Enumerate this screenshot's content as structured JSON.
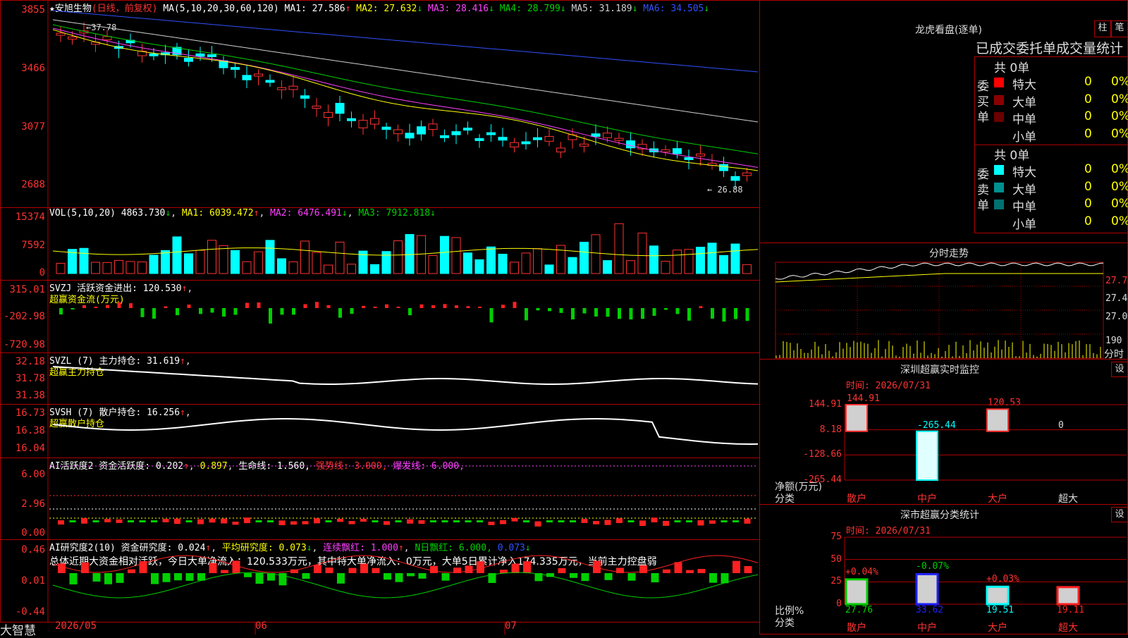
{
  "stock": {
    "name": "★安旭生物",
    "mode": "(日线，前复权)",
    "ma_params": "MA(5,10,20,30,60,120)",
    "ma": [
      {
        "label": "MA1:",
        "value": "27.586",
        "arrow": "↑",
        "color": "#ffffff"
      },
      {
        "label": "MA2:",
        "value": "27.632",
        "arrow": "↓",
        "color": "#ffff00"
      },
      {
        "label": "MA3:",
        "value": "28.416",
        "arrow": "↓",
        "color": "#ff40ff"
      },
      {
        "label": "MA4:",
        "value": "28.799",
        "arrow": "↓",
        "color": "#00d000"
      },
      {
        "label": "MA5:",
        "value": "31.189",
        "arrow": "↓",
        "color": "#d0d0d0"
      },
      {
        "label": "MA6:",
        "value": "34.505",
        "arrow": "↓",
        "color": "#3050ff"
      }
    ]
  },
  "price_axis": [
    "3855",
    "3466",
    "3077",
    "2688"
  ],
  "price_marks": {
    "high": "37.78",
    "low": "26.88"
  },
  "vol": {
    "title": "VOL(5,10,20)",
    "value": "4863.730",
    "value_arrow": "↓",
    "ma1": "6039.472",
    "ma1_arrow": "↑",
    "ma2": "6476.491",
    "ma2_arrow": "↓",
    "ma3": "7912.818",
    "ma3_arrow": "↓",
    "axis": [
      "15374",
      "7592",
      "0"
    ]
  },
  "svzj": {
    "title": "SVZJ  活跃资金进出: 120.530",
    "arrow": "↑",
    "sub": "超赢资金流(万元)",
    "axis": [
      "315.01",
      "-202.98",
      "-720.98"
    ]
  },
  "svzl": {
    "title": "SVZL (7) 主力持仓: 31.619",
    "arrow": "↑",
    "sub": "超赢主力持仓",
    "axis": [
      "32.18",
      "31.78",
      "31.38"
    ]
  },
  "svsh": {
    "title": "SVSH (7) 散户持仓: 16.256",
    "arrow": "↑",
    "sub": "超赢散户持仓",
    "axis": [
      "16.73",
      "16.38",
      "16.04"
    ]
  },
  "ai_active": {
    "title": "AI活跃度2 资金活跃度: 0.202",
    "v1_arrow": "↑",
    "v2": "0.897",
    "life": "生命线: 1.560,",
    "strong": "强势线: 3.000,",
    "burst": "爆发线: 6.000,",
    "axis": [
      "6.00",
      "2.96",
      "0.00"
    ]
  },
  "ai_research": {
    "title": "AI研究度2(10) 资金研究度: 0.024",
    "t_arrow": "↑",
    "avg": "平均研究度: 0.073",
    "avg_arrow": "↓",
    "cont": "连续飘红: 1.000",
    "cont_arrow": "↑",
    "nday": "N日飘红: 6.000,",
    "last": "0.073",
    "last_arrow": "↓",
    "summary": "总体近期大资金相对活跃，今日大单净流入：120.533万元，其中特大单净流入：0万元，大单5日累计净入174.335万元，当前主力控盘弱",
    "axis": [
      "0.46",
      "0.01",
      "-0.44"
    ]
  },
  "date_axis": [
    "2026/05",
    "06",
    "07"
  ],
  "brand": "大智慧",
  "right": {
    "top_title": "龙虎看盘(逐单)",
    "btn_zhu": "柱",
    "btn_bi": "笔",
    "stat_title": "已成交委托单成交量统计",
    "buy_label": "委买单",
    "sell_label": "委卖单",
    "buy_total": "共 0单",
    "sell_total": "共 0单",
    "buy_rows": [
      {
        "name": "特大",
        "v": "0",
        "p": "0%",
        "color": "#ff0000"
      },
      {
        "name": "大单",
        "v": "0",
        "p": "0%",
        "color": "#8b0000"
      },
      {
        "name": "中单",
        "v": "0",
        "p": "0%",
        "color": "#6a0000"
      },
      {
        "name": "小单",
        "v": "0",
        "p": "0%",
        "color": "#000000"
      }
    ],
    "sell_rows": [
      {
        "name": "特大",
        "v": "0",
        "p": "0%",
        "color": "#00ffff"
      },
      {
        "name": "大单",
        "v": "0",
        "p": "0%",
        "color": "#009090"
      },
      {
        "name": "中单",
        "v": "0",
        "p": "0%",
        "color": "#007070"
      },
      {
        "name": "小单",
        "v": "0",
        "p": "0%",
        "color": "#000000"
      }
    ],
    "intraday_title": "分时走势",
    "intraday_axis": [
      "27.7",
      "27.40",
      "27.06"
    ],
    "intraday_vol": "190",
    "intraday_label": "分时",
    "monitor_title": "深圳超赢实时监控",
    "monitor_btn": "设",
    "monitor_time": "时间: 2026/07/31",
    "monitor_axis": [
      "144.91",
      "8.18",
      "-128.66",
      "-265.44"
    ],
    "monitor_ylabel1": "净额(万元)",
    "monitor_ylabel2": "分类",
    "monitor_bars": [
      {
        "cat": "散户",
        "value": 144.91,
        "label": "144.91"
      },
      {
        "cat": "中户",
        "value": -265.44,
        "label": "-265.44"
      },
      {
        "cat": "大户",
        "value": 120.53,
        "label": "120.53"
      },
      {
        "cat": "超大",
        "value": 0,
        "label": "0"
      }
    ],
    "class_title": "深市超赢分类统计",
    "class_btn": "设",
    "class_time": "时间: 2026/07/31",
    "class_axis": [
      "75",
      "50",
      "25",
      "0"
    ],
    "class_ylabel1": "比例%",
    "class_ylabel2": "分类",
    "class_bars": [
      {
        "cat": "散户",
        "value": 27.76,
        "label": "27.76",
        "change": "+0.04%",
        "color": "#00d000"
      },
      {
        "cat": "中户",
        "value": 33.62,
        "label": "33.62",
        "change": "-0.07%",
        "color": "#2020ff"
      },
      {
        "cat": "大户",
        "value": 19.51,
        "label": "19.51",
        "change": "+0.03%",
        "color": "#00ffff"
      },
      {
        "cat": "超大",
        "value": 19.11,
        "label": "19.11",
        "change": "",
        "color": "#ff2020"
      }
    ]
  }
}
